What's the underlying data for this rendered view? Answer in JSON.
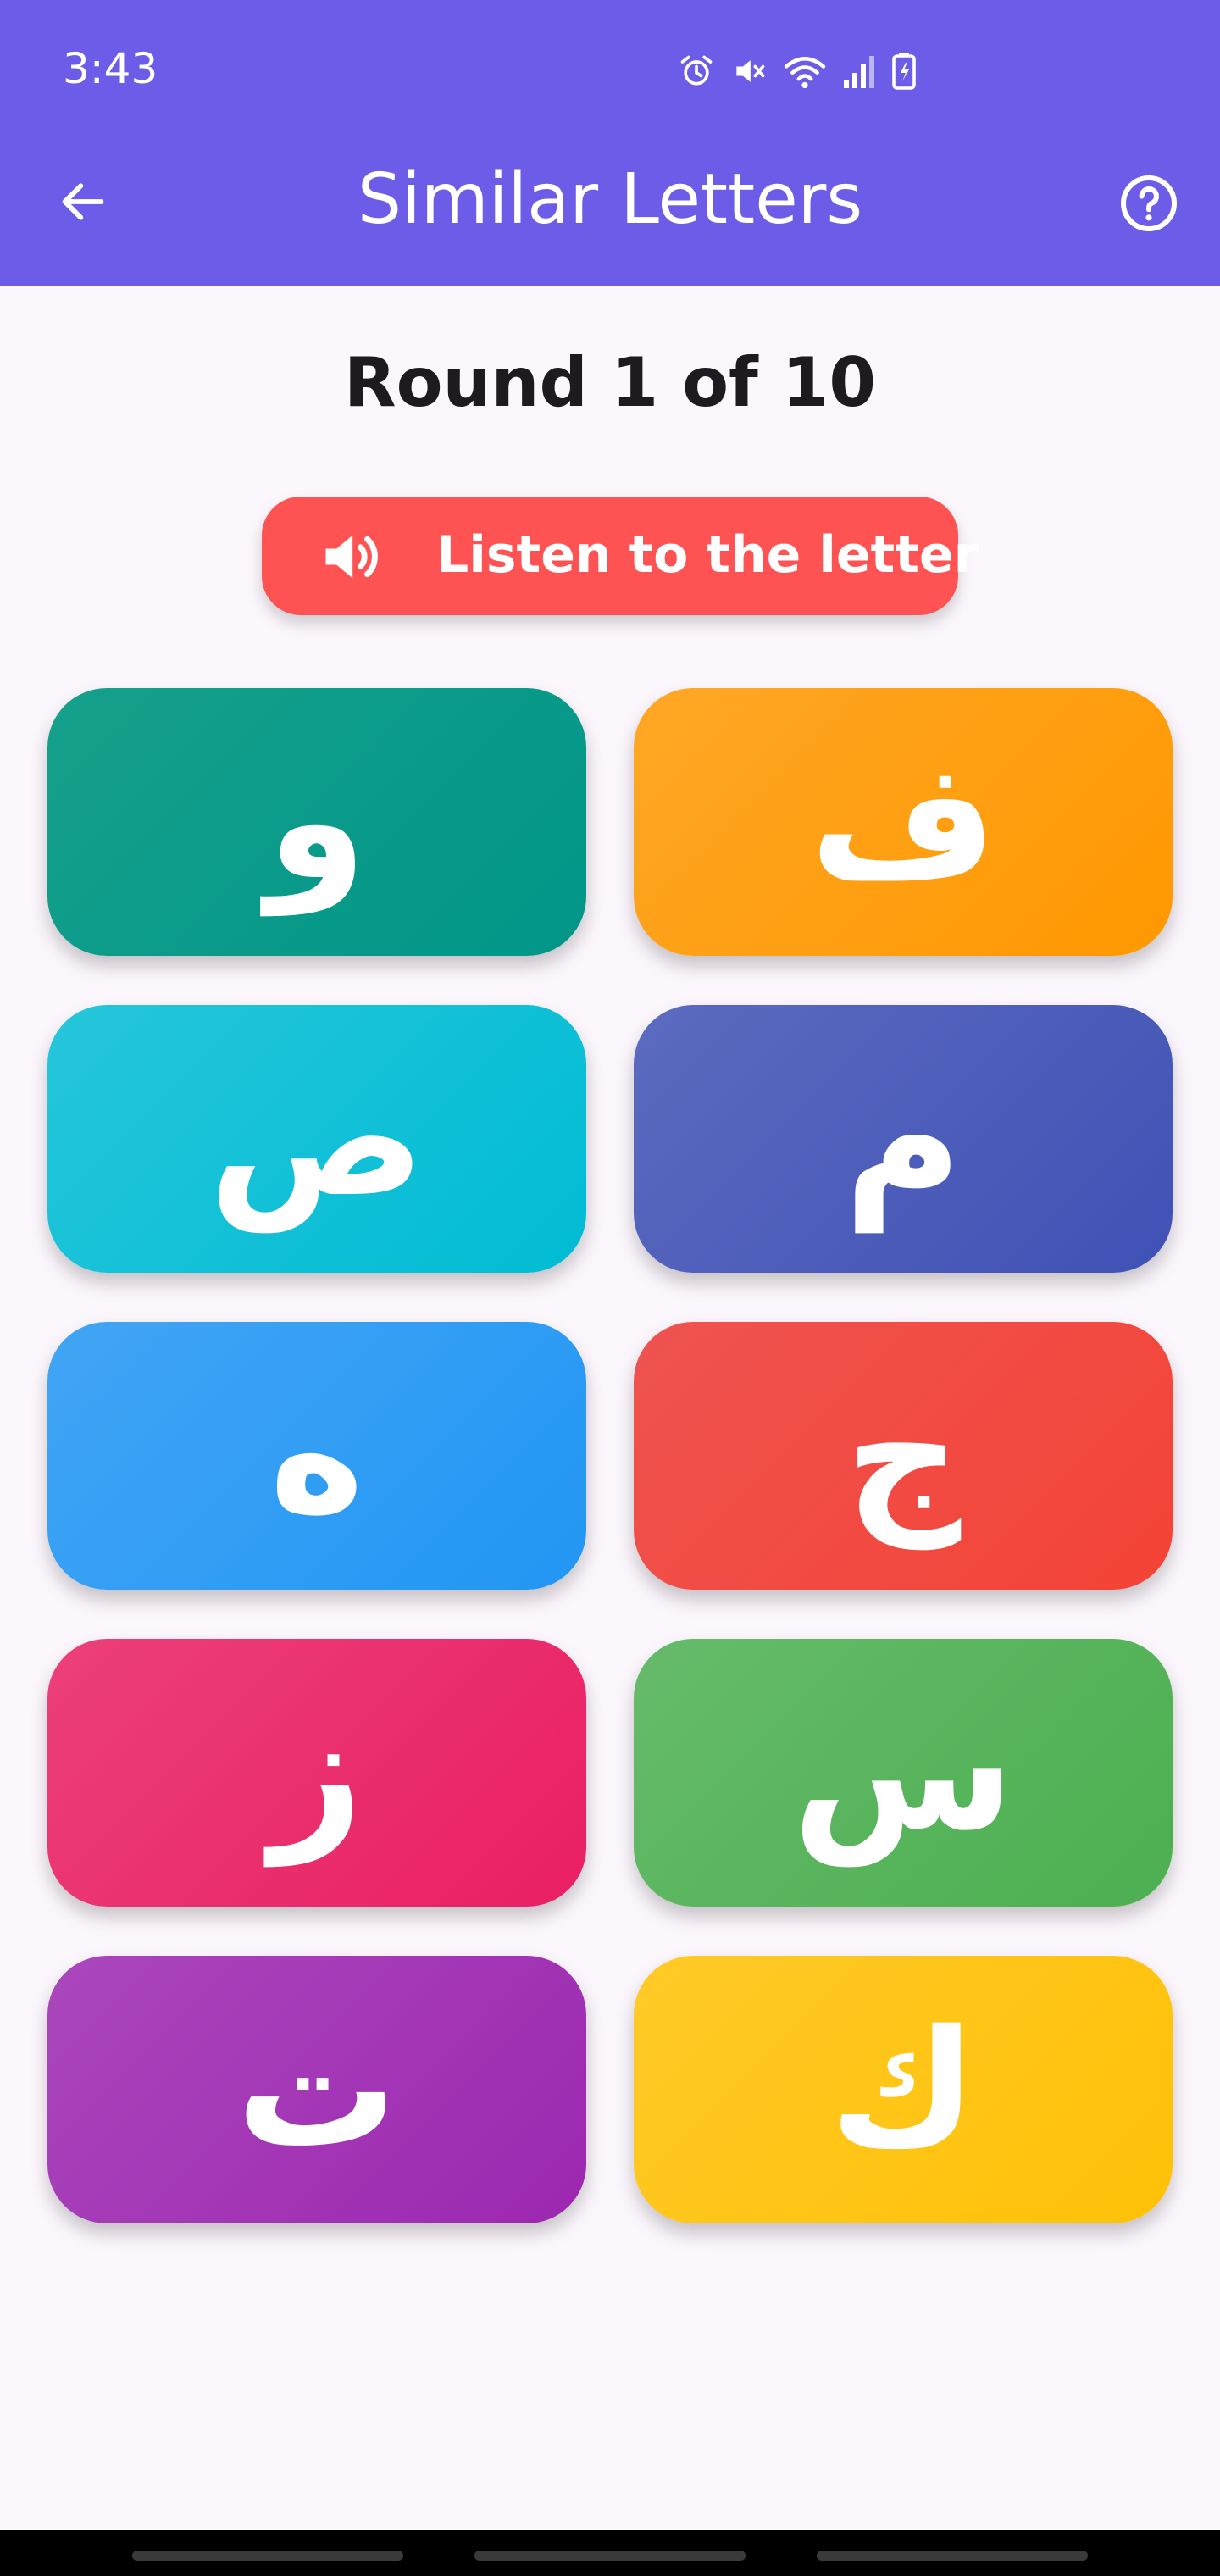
{
  "status_bar": {
    "time": "3:43",
    "icons": [
      "alarm-icon",
      "mute-icon",
      "wifi-icon",
      "signal-icon",
      "battery-icon"
    ]
  },
  "app_bar": {
    "title": "Similar Letters",
    "back_icon": "arrow-left-icon",
    "help_icon": "help-circle-icon",
    "color": "#6c5ce7"
  },
  "game": {
    "round_label": "Round 1 of 10",
    "listen_button": {
      "label": "Listen to the letter",
      "icon": "speaker-icon",
      "color": "#ff5252"
    },
    "tiles": [
      {
        "letter": "و",
        "color_from": "#16a08b",
        "color_to": "#009688"
      },
      {
        "letter": "ف",
        "color_from": "#ffa726",
        "color_to": "#ff9800"
      },
      {
        "letter": "ص",
        "color_from": "#26c6da",
        "color_to": "#00bcd4"
      },
      {
        "letter": "م",
        "color_from": "#5c6bc0",
        "color_to": "#3f51b5"
      },
      {
        "letter": "ه",
        "color_from": "#42a5f5",
        "color_to": "#2196f3"
      },
      {
        "letter": "ج",
        "color_from": "#ef5350",
        "color_to": "#f44336"
      },
      {
        "letter": "ز",
        "color_from": "#ec407a",
        "color_to": "#e91e63"
      },
      {
        "letter": "س",
        "color_from": "#66bb6a",
        "color_to": "#4caf50"
      },
      {
        "letter": "ت",
        "color_from": "#ab47bc",
        "color_to": "#9c27b0"
      },
      {
        "letter": "ك",
        "color_from": "#ffca28",
        "color_to": "#ffc107"
      }
    ]
  }
}
